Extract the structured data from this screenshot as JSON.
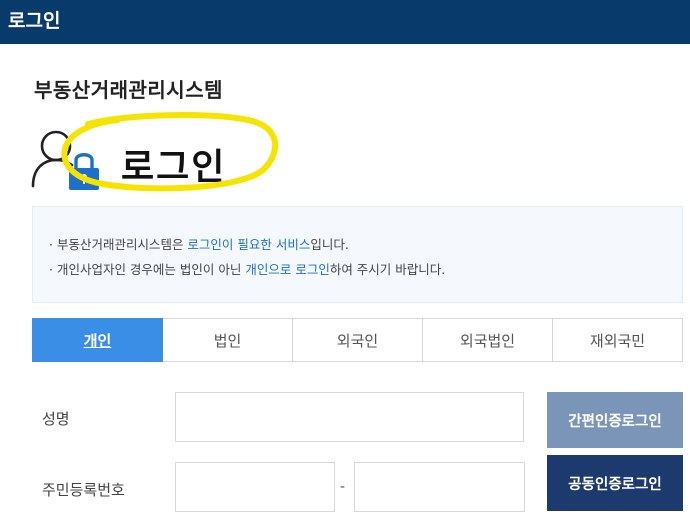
{
  "header": {
    "title": "로그인"
  },
  "system_title": "부동산거래관리시스템",
  "login_heading": "로그인",
  "info": {
    "line1": {
      "prefix": "· 부동산거래관리시스템은 ",
      "highlight": "로그인이 필요한 서비스",
      "suffix": "입니다."
    },
    "line2": {
      "prefix": "· 개인사업자인 경우에는 법인이 아닌 ",
      "highlight": "개인으로 로그인",
      "suffix": "하여 주시기 바랍니다."
    }
  },
  "tabs": [
    {
      "label": "개인",
      "active": true
    },
    {
      "label": "법인",
      "active": false
    },
    {
      "label": "외국인",
      "active": false
    },
    {
      "label": "외국법인",
      "active": false
    },
    {
      "label": "재외국민",
      "active": false
    }
  ],
  "form": {
    "name_label": "성명",
    "rrn_label": "주민등록번호",
    "name_value": "",
    "rrn_front_value": "",
    "rrn_back_value": "",
    "dash": "-"
  },
  "buttons": {
    "simple_cert": "간편인증로그인",
    "joint_cert": "공동인증로그인"
  },
  "colors": {
    "header_bg": "#083a6b",
    "active_tab": "#3a8ee6",
    "link_blue": "#1e6fc8",
    "simple_btn": "#7a95b8",
    "joint_btn": "#1d3a6e",
    "highlight_yellow": "#f5e400"
  },
  "icons": {
    "login_icon": "user-lock-icon"
  }
}
